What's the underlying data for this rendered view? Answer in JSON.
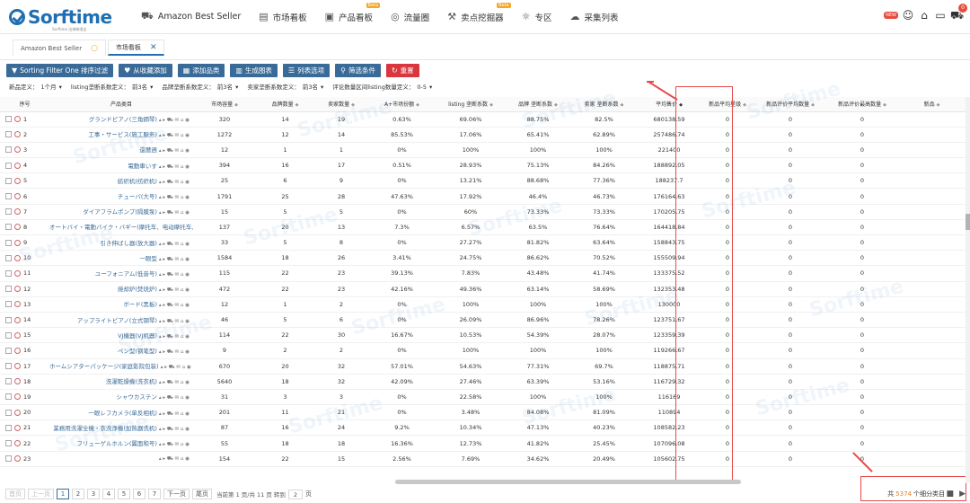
{
  "brand": {
    "name": "Sorftime",
    "sub": "Sorftime 出海跨境宝"
  },
  "nav": [
    {
      "icon": "cart-icon",
      "glyph": "⛟",
      "label": "Amazon Best Seller",
      "beta": ""
    },
    {
      "icon": "board-icon",
      "glyph": "▤",
      "label": "市场看板",
      "beta": ""
    },
    {
      "icon": "product-board-icon",
      "glyph": "▣",
      "label": "产品看板",
      "beta": "Beta"
    },
    {
      "icon": "traffic-icon",
      "glyph": "◎",
      "label": "流量圈",
      "beta": ""
    },
    {
      "icon": "mining-icon",
      "glyph": "⚒",
      "label": "卖点挖掘器",
      "beta": "Beta"
    },
    {
      "icon": "bulb-icon",
      "glyph": "☼",
      "label": "专区",
      "beta": ""
    },
    {
      "icon": "collect-icon",
      "glyph": "☁",
      "label": "采集列表",
      "beta": ""
    }
  ],
  "top_right": {
    "new_label": "NEW",
    "cart_count": "0"
  },
  "tabs": [
    {
      "label": "Amazon Best Seller",
      "close": "○"
    },
    {
      "label": "市场看板",
      "close": "✕"
    }
  ],
  "toolbar": [
    {
      "icon": "filter-icon",
      "glyph": "▼",
      "label": "Sorting Filter One 排序过滤",
      "red": false
    },
    {
      "icon": "favorite-icon",
      "glyph": "♥",
      "label": "从收藏添加",
      "red": false
    },
    {
      "icon": "add-category-icon",
      "glyph": "▦",
      "label": "添加品类",
      "red": false
    },
    {
      "icon": "chart-icon",
      "glyph": "▥",
      "label": "生成图表",
      "red": false
    },
    {
      "icon": "list-icon",
      "glyph": "☰",
      "label": "列表选项",
      "red": false
    },
    {
      "icon": "filter-condition-icon",
      "glyph": "⚲",
      "label": "筛选条件",
      "red": false
    },
    {
      "icon": "reset-icon",
      "glyph": "↻",
      "label": "重置",
      "red": true
    }
  ],
  "filters": [
    {
      "label": "新品定义：",
      "value": "1个月",
      "arrow": "▾"
    },
    {
      "label": "listing垄断系数定义：",
      "value": "前3名",
      "arrow": "▾"
    },
    {
      "label": "品牌垄断系数定义：",
      "value": "前3名",
      "arrow": "▾"
    },
    {
      "label": "卖家垄断系数定义：",
      "value": "前3名",
      "arrow": "▾"
    },
    {
      "label": "评论数量区间listing数量定义：",
      "value": "0-5",
      "arrow": "▾"
    }
  ],
  "columns": [
    "序号",
    "产品类目",
    "市场容量",
    "品牌数量",
    "卖家数量",
    "A+市场份额",
    "listing 垄断系数",
    "品牌 垄断系数",
    "卖家 垄断系数",
    "平均售价",
    "新品平均星级",
    "新品评价平均数量",
    "新品评价最高数量",
    "新品"
  ],
  "rows": [
    [
      "1",
      "グランドピアノ(三角鋼琴)",
      "320",
      "14",
      "19",
      "0.63%",
      "69.06%",
      "88.75%",
      "82.5%",
      "680138.59",
      "0",
      "0",
      "0"
    ],
    [
      "2",
      "工事・サービス(施工服务)",
      "1272",
      "12",
      "14",
      "85.53%",
      "17.06%",
      "65.41%",
      "62.89%",
      "257486.74",
      "0",
      "0",
      "0"
    ],
    [
      "3",
      "還暦週",
      "12",
      "1",
      "1",
      "0%",
      "100%",
      "100%",
      "100%",
      "221400",
      "0",
      "0",
      "0"
    ],
    [
      "4",
      "電動車いす",
      "394",
      "16",
      "17",
      "0.51%",
      "28.93%",
      "75.13%",
      "84.26%",
      "188892.05",
      "0",
      "0",
      "0"
    ],
    [
      "5",
      "紡织机(纺织机)",
      "25",
      "6",
      "9",
      "0%",
      "13.21%",
      "88.68%",
      "77.36%",
      "188237.7",
      "0",
      "0",
      "0"
    ],
    [
      "6",
      "チューバ(大号)",
      "1791",
      "25",
      "28",
      "47.63%",
      "17.92%",
      "46.4%",
      "46.73%",
      "176164.63",
      "0",
      "0",
      "0"
    ],
    [
      "7",
      "ダイアフラムポンプ(隔膜泵)",
      "15",
      "5",
      "5",
      "0%",
      "60%",
      "73.33%",
      "73.33%",
      "170205.75",
      "0",
      "0",
      "0"
    ],
    [
      "8",
      "オートバイ・電動バイク・バギー(摩托车、电动摩托车、四轮)",
      "137",
      "20",
      "13",
      "7.3%",
      "6.57%",
      "63.5%",
      "76.64%",
      "164418.84",
      "0",
      "0",
      "0"
    ],
    [
      "9",
      "引き伸ばし器(放大器)",
      "33",
      "5",
      "8",
      "0%",
      "27.27%",
      "81.82%",
      "63.64%",
      "158843.75",
      "0",
      "0",
      "0"
    ],
    [
      "10",
      "一眼型",
      "1584",
      "18",
      "26",
      "3.41%",
      "24.75%",
      "86.62%",
      "70.52%",
      "155509.94",
      "0",
      "0",
      "0"
    ],
    [
      "11",
      "ユーフォニアム(低音号)",
      "115",
      "22",
      "23",
      "39.13%",
      "7.83%",
      "43.48%",
      "41.74%",
      "133375.52",
      "0",
      "0",
      "0"
    ],
    [
      "12",
      "焼却炉(焚烧炉)",
      "472",
      "22",
      "23",
      "42.16%",
      "49.36%",
      "63.14%",
      "58.69%",
      "132353.48",
      "0",
      "0",
      "0"
    ],
    [
      "13",
      "ボード(黑板)",
      "12",
      "1",
      "2",
      "0%",
      "100%",
      "100%",
      "100%",
      "130000",
      "0",
      "0",
      "0"
    ],
    [
      "14",
      "アップライトピアノ(立式钢琴)",
      "46",
      "5",
      "6",
      "0%",
      "26.09%",
      "86.96%",
      "78.26%",
      "123751.67",
      "0",
      "0",
      "0"
    ],
    [
      "15",
      "VJ機器(VJ机器)",
      "114",
      "22",
      "30",
      "16.67%",
      "10.53%",
      "54.39%",
      "28.07%",
      "123359.39",
      "0",
      "0",
      "0"
    ],
    [
      "16",
      "ペン型(钢笔型)",
      "9",
      "2",
      "2",
      "0%",
      "100%",
      "100%",
      "100%",
      "119266.67",
      "0",
      "0",
      "0"
    ],
    [
      "17",
      "ホームシアターパッケージ(家庭影院包装)",
      "670",
      "20",
      "32",
      "57.01%",
      "54.63%",
      "77.31%",
      "69.7%",
      "118875.71",
      "0",
      "0",
      "0"
    ],
    [
      "18",
      "洗濯乾燥機(洗衣机)",
      "5640",
      "18",
      "32",
      "42.09%",
      "27.46%",
      "63.39%",
      "53.16%",
      "116729.32",
      "0",
      "0",
      "0"
    ],
    [
      "19",
      "シャウカステン",
      "31",
      "3",
      "3",
      "0%",
      "22.58%",
      "100%",
      "100%",
      "116169",
      "0",
      "0",
      "0"
    ],
    [
      "20",
      "一眼レフカメラ(单反相机)",
      "201",
      "11",
      "21",
      "0%",
      "3.48%",
      "84.08%",
      "81.09%",
      "110894",
      "0",
      "0",
      "0"
    ],
    [
      "21",
      "業務用洗濯全機・衣洗浄機(加热器洗机)",
      "87",
      "16",
      "24",
      "9.2%",
      "10.34%",
      "47.13%",
      "40.23%",
      "108582.23",
      "0",
      "0",
      "0"
    ],
    [
      "22",
      "フリューゲルホルン(翼面和号)",
      "55",
      "18",
      "18",
      "16.36%",
      "12.73%",
      "41.82%",
      "25.45%",
      "107096.08",
      "0",
      "0",
      "0"
    ],
    [
      "23",
      "",
      "154",
      "22",
      "15",
      "2.56%",
      "7.69%",
      "34.62%",
      "20.49%",
      "105602.75",
      "0",
      "0",
      "0"
    ]
  ],
  "pagination": {
    "first": "首页",
    "prev": "上一页",
    "pages": [
      "1",
      "2",
      "3",
      "4",
      "5",
      "6",
      "7"
    ],
    "next": "下一页",
    "last": "尾页",
    "info": "当前第 1 页/共 11 页 转到",
    "goto": "2",
    "goto_suffix": "页",
    "total_prefix": "共",
    "total_count": "5374",
    "total_suffix": "个细分类目"
  },
  "watermark": "Sorftime",
  "colors": {
    "brand": "#1f6fb2",
    "button": "#3a6b98",
    "reset": "#d9363e",
    "annotation": "#e94b4b"
  }
}
